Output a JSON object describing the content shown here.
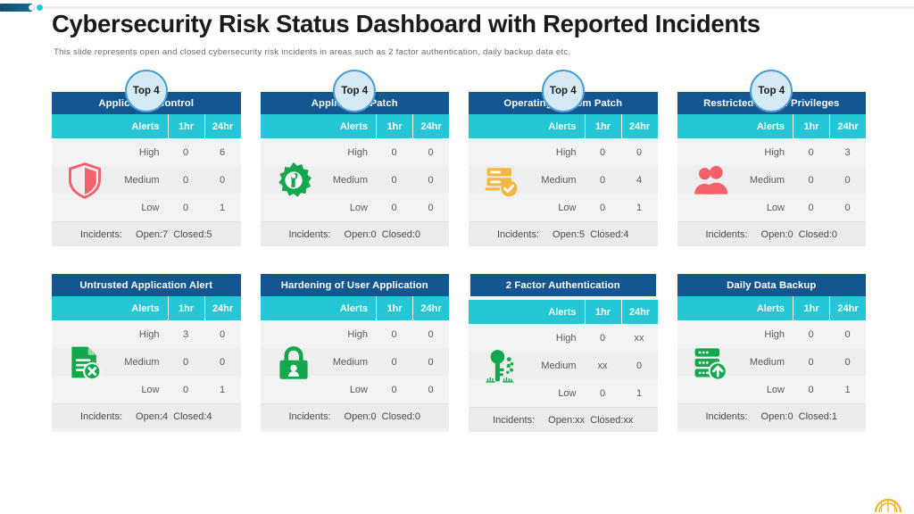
{
  "header": {
    "title": "Cybersecurity Risk Status Dashboard with Reported Incidents",
    "subtitle": "This slide represents open and closed cybersecurity risk incidents in areas such as 2 factor authentication, daily backup data etc."
  },
  "table_labels": {
    "alerts": "Alerts",
    "col_1hr": "1hr",
    "col_24hr": "24hr",
    "high": "High",
    "medium": "Medium",
    "low": "Low",
    "incidents": "Incidents:",
    "open_prefix": "Open:",
    "closed_prefix": "Closed:"
  },
  "badge_label": "Top 4",
  "colors": {
    "header_blue": "#14568f",
    "alerts_cyan": "#25c6d6",
    "badge_fill": "#d6eaf6",
    "badge_ring": "#4a9ed4",
    "icon_red": "#f4616a",
    "icon_green": "#13a84e",
    "icon_orange": "#f5b943",
    "card_body": "#f3f3f3"
  },
  "cards": [
    {
      "title": "Application Control",
      "icon": "shield-icon",
      "icon_color": "#f4616a",
      "has_badge": true,
      "offset_head": false,
      "rows": [
        {
          "label": "High",
          "hr1": "0",
          "hr24": "6"
        },
        {
          "label": "Medium",
          "hr1": "0",
          "hr24": "0"
        },
        {
          "label": "Low",
          "hr1": "0",
          "hr24": "1"
        }
      ],
      "open": "7",
      "closed": "5"
    },
    {
      "title": "Application Patch",
      "icon": "gear-wrench-icon",
      "icon_color": "#13a84e",
      "has_badge": true,
      "offset_head": false,
      "rows": [
        {
          "label": "High",
          "hr1": "0",
          "hr24": "0"
        },
        {
          "label": "Medium",
          "hr1": "0",
          "hr24": "0"
        },
        {
          "label": "Low",
          "hr1": "0",
          "hr24": "0"
        }
      ],
      "open": "0",
      "closed": "0"
    },
    {
      "title": "Operating System Patch",
      "icon": "document-check-icon",
      "icon_color": "#f5b943",
      "has_badge": true,
      "offset_head": false,
      "rows": [
        {
          "label": "High",
          "hr1": "0",
          "hr24": "0"
        },
        {
          "label": "Medium",
          "hr1": "0",
          "hr24": "4"
        },
        {
          "label": "Low",
          "hr1": "0",
          "hr24": "1"
        }
      ],
      "open": "5",
      "closed": "4"
    },
    {
      "title": "Restricted Admin Privileges",
      "icon": "users-icon",
      "icon_color": "#f4616a",
      "has_badge": true,
      "offset_head": false,
      "rows": [
        {
          "label": "High",
          "hr1": "0",
          "hr24": "3"
        },
        {
          "label": "Medium",
          "hr1": "0",
          "hr24": "0"
        },
        {
          "label": "Low",
          "hr1": "0",
          "hr24": "0"
        }
      ],
      "open": "0",
      "closed": "0"
    },
    {
      "title": "Untrusted Application Alert",
      "icon": "document-x-icon",
      "icon_color": "#13a84e",
      "has_badge": false,
      "offset_head": false,
      "rows": [
        {
          "label": "High",
          "hr1": "3",
          "hr24": "0"
        },
        {
          "label": "Medium",
          "hr1": "0",
          "hr24": "0"
        },
        {
          "label": "Low",
          "hr1": "0",
          "hr24": "1"
        }
      ],
      "open": "4",
      "closed": "4"
    },
    {
      "title": "Hardening of User Application",
      "icon": "lock-user-icon",
      "icon_color": "#13a84e",
      "has_badge": false,
      "offset_head": false,
      "rows": [
        {
          "label": "High",
          "hr1": "0",
          "hr24": "0"
        },
        {
          "label": "Medium",
          "hr1": "0",
          "hr24": "0"
        },
        {
          "label": "Low",
          "hr1": "0",
          "hr24": "0"
        }
      ],
      "open": "0",
      "closed": "0"
    },
    {
      "title": "2 Factor Authentication",
      "icon": "key-icon",
      "icon_color": "#13a84e",
      "has_badge": false,
      "offset_head": true,
      "rows": [
        {
          "label": "High",
          "hr1": "0",
          "hr24": "xx"
        },
        {
          "label": "Medium",
          "hr1": "xx",
          "hr24": "0"
        },
        {
          "label": "Low",
          "hr1": "0",
          "hr24": "1"
        }
      ],
      "open": "xx",
      "closed": "xx"
    },
    {
      "title": "Daily Data Backup",
      "icon": "server-upload-icon",
      "icon_color": "#13a84e",
      "has_badge": false,
      "offset_head": false,
      "rows": [
        {
          "label": "High",
          "hr1": "0",
          "hr24": "0"
        },
        {
          "label": "Medium",
          "hr1": "0",
          "hr24": "0"
        },
        {
          "label": "Low",
          "hr1": "0",
          "hr24": "1"
        }
      ],
      "open": "0",
      "closed": "1"
    }
  ]
}
